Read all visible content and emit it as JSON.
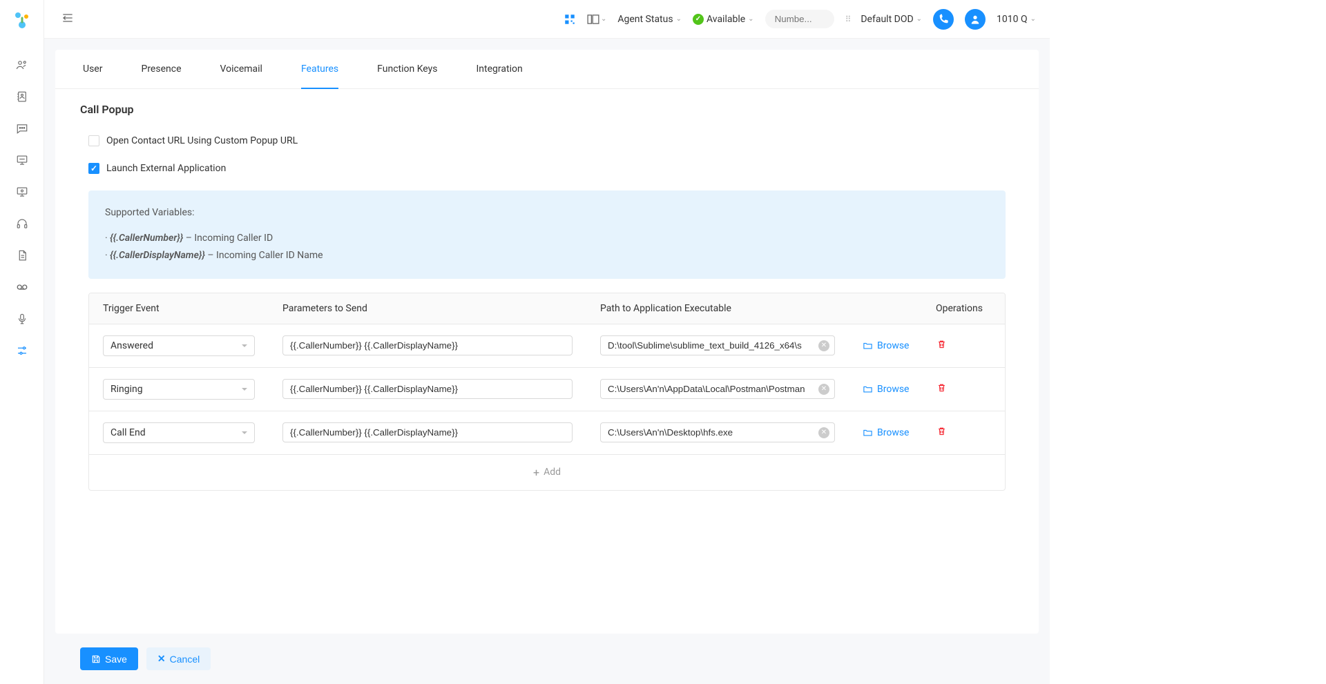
{
  "header": {
    "agent_status_label": "Agent Status",
    "availability": "Available",
    "search_placeholder": "Numbe...",
    "default_dod": "Default DOD",
    "user_code": "1010 Q"
  },
  "tabs": [
    {
      "label": "User",
      "active": false
    },
    {
      "label": "Presence",
      "active": false
    },
    {
      "label": "Voicemail",
      "active": false
    },
    {
      "label": "Features",
      "active": true
    },
    {
      "label": "Function Keys",
      "active": false
    },
    {
      "label": "Integration",
      "active": false
    }
  ],
  "page": {
    "title": "Call Popup",
    "checkbox_url": {
      "checked": false,
      "label": "Open Contact URL Using Custom Popup URL"
    },
    "checkbox_launch": {
      "checked": true,
      "label": "Launch External Application"
    },
    "info": {
      "heading": "Supported Variables:",
      "var1": "{{.CallerNumber}}",
      "var1_desc": " – Incoming Caller ID",
      "var2": "{{.CallerDisplayName}}",
      "var2_desc": " – Incoming Caller ID Name"
    },
    "table": {
      "headers": {
        "trigger": "Trigger Event",
        "params": "Parameters to Send",
        "path": "Path to Application Executable",
        "ops": "Operations"
      },
      "rows": [
        {
          "trigger": "Answered",
          "params": "{{.CallerNumber}} {{.CallerDisplayName}}",
          "path": "D:\\tool\\Sublime\\sublime_text_build_4126_x64\\s"
        },
        {
          "trigger": "Ringing",
          "params": "{{.CallerNumber}} {{.CallerDisplayName}}",
          "path": "C:\\Users\\An'n\\AppData\\Local\\Postman\\Postman"
        },
        {
          "trigger": "Call End",
          "params": "{{.CallerNumber}} {{.CallerDisplayName}}",
          "path": "C:\\Users\\An'n\\Desktop\\hfs.exe"
        }
      ],
      "browse_label": "Browse",
      "add_label": "Add"
    }
  },
  "footer": {
    "save": "Save",
    "cancel": "Cancel"
  }
}
